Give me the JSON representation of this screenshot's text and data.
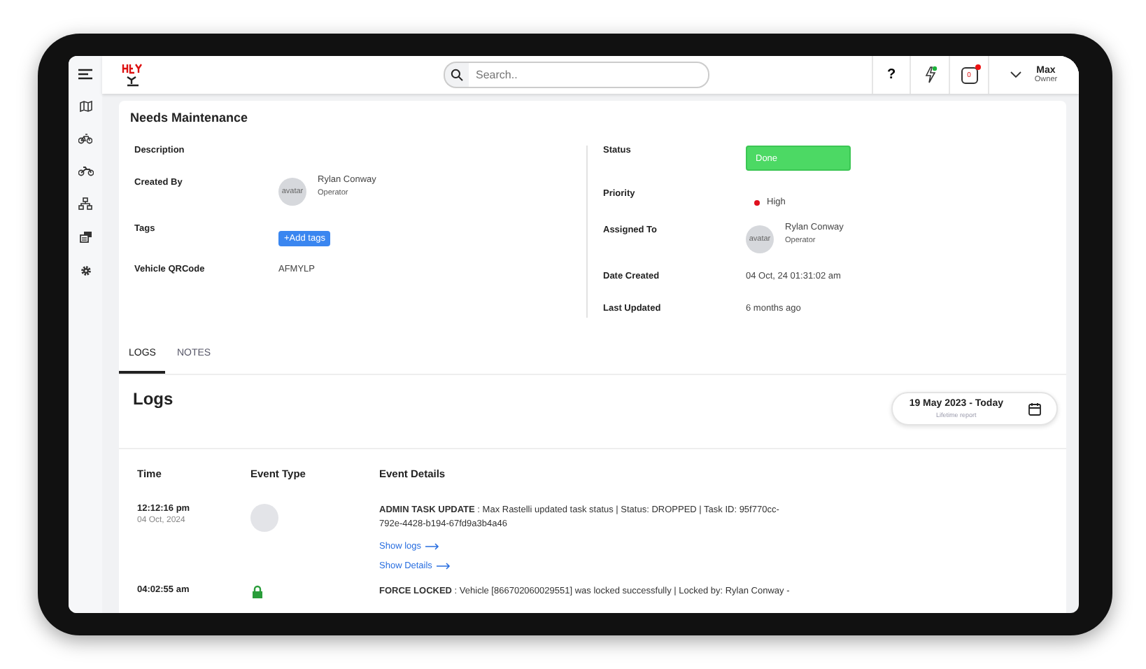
{
  "topbar": {
    "search": {
      "placeholder": "Search.."
    },
    "help": "?",
    "alerts_count": "0",
    "user": {
      "name": "Max",
      "role": "Owner"
    }
  },
  "task": {
    "title": "Needs Maintenance",
    "left_fields": [
      {
        "label": "Description",
        "kind": "empty"
      },
      {
        "label": "Created By",
        "kind": "person",
        "avatar": "avatar",
        "name": "Rylan Conway",
        "role": "Operator"
      },
      {
        "label": "Tags",
        "kind": "button",
        "value": "+Add tags"
      },
      {
        "label": "Vehicle QRCode",
        "kind": "text",
        "value": "AFMYLP"
      }
    ],
    "right_fields": [
      {
        "label": "Status",
        "kind": "status",
        "value": "Done"
      },
      {
        "label": "Priority",
        "kind": "priority",
        "value": "High",
        "color": "#e0101e"
      },
      {
        "label": "Assigned To",
        "kind": "person",
        "avatar": "avatar",
        "name": "Rylan Conway",
        "role": "Operator"
      },
      {
        "label": "Date Created",
        "kind": "text",
        "value": "04 Oct, 24 01:31:02 am"
      },
      {
        "label": "Last Updated",
        "kind": "text",
        "value": "6 months ago"
      }
    ]
  },
  "tabs": [
    {
      "label": "LOGS",
      "selected": true
    },
    {
      "label": "NOTES",
      "selected": false
    }
  ],
  "logs": {
    "title": "Logs",
    "date_range": "19 May 2023 - Today",
    "range_caption": "Lifetime report",
    "columns": [
      "Time",
      "Event Type",
      "Event Details"
    ],
    "rows": [
      {
        "time": "12:12:16 pm",
        "date": "04 Oct, 2024",
        "kind": "blank",
        "details": "**ADMIN TASK UPDATE** : Max Rastelli updated task status | Status: DROPPED | Task ID: 95f770cc-792e-4428-b194-67fd9a3b4a46",
        "links": [
          "Show logs",
          "Show Details"
        ]
      },
      {
        "time": "04:02:55 am",
        "kind": "lock",
        "details": "**FORCE LOCKED** : Vehicle [866702060029551] was locked successfully | Locked by: Rylan Conway -"
      }
    ]
  }
}
